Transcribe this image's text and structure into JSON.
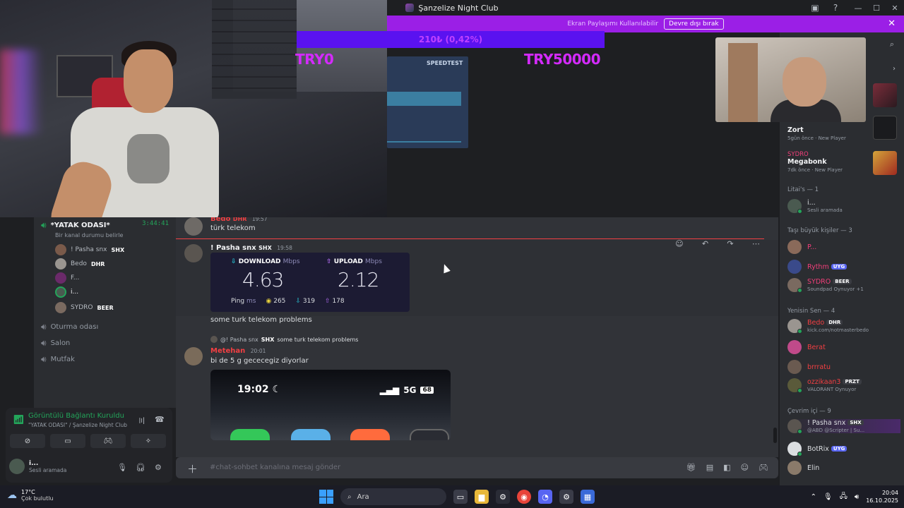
{
  "window": {
    "title": "Şanzelize Night Club"
  },
  "notice": {
    "text": "Ekran Paylaşımı Kullanılabilir",
    "button": "Devre dışı bırak"
  },
  "overlay": {
    "bar_text": "210₺ (0,42%)",
    "min_label": "TRY0",
    "max_label": "TRY50000",
    "speedtest_label": "SPEEDTEST"
  },
  "voice": {
    "channel_name": "*YATAK ODASI*",
    "channel_time": "3:44:41",
    "channel_status": "Bir kanal durumu belirle",
    "members": [
      {
        "name": "! Pasha snx",
        "tag": "SHX"
      },
      {
        "name": "Bedo",
        "tag": "DHR"
      },
      {
        "name": "F...",
        "tag": ""
      },
      {
        "name": "i...",
        "tag": ""
      },
      {
        "name": "SYDRO",
        "tag": "BEER"
      }
    ],
    "channels": [
      "Oturma odası",
      "Salon",
      "Mutfak"
    ]
  },
  "voice_panel": {
    "status": "Görüntülü Bağlantı Kuruldu",
    "location": "\"YATAK ODASI\" / Şanzelize Night Club",
    "user_name": "i...",
    "user_status": "Sesli aramada"
  },
  "chat": {
    "messages": [
      {
        "author": "Bedo",
        "tag": "DHR",
        "time": "19:57",
        "text": "türk telekom"
      },
      {
        "author": "! Pasha snx",
        "tag": "SHX",
        "time": "19:58",
        "text": "some turk telekom problems"
      },
      {
        "author": "Metehan",
        "tag": "",
        "time": "20:01",
        "text": "bi de 5 g gececegiz diyorlar"
      }
    ],
    "reply": {
      "author": "@! Pasha snx",
      "tag": "SHX",
      "text": "some turk telekom problems"
    },
    "speedtest": {
      "download_label": "DOWNLOAD",
      "upload_label": "UPLOAD",
      "unit": "Mbps",
      "download": "4.63",
      "upload": "2.12",
      "ping_label": "Ping",
      "ping_unit": "ms",
      "ping": "265",
      "ping_down": "319",
      "ping_up": "178"
    },
    "phone": {
      "time": "19:02",
      "network": "5G",
      "battery": "68"
    },
    "input_placeholder": "#chat-sohbet kanalına mesaj gönder"
  },
  "member_list": {
    "activities": [
      {
        "user": "",
        "title": "Zort",
        "age": "5gün önce",
        "badge": "New Player"
      },
      {
        "user": "SYDRO",
        "title": "Megabonk",
        "age": "7dk önce",
        "badge": "New Player"
      }
    ],
    "groups": [
      {
        "header": "Litai's — 1",
        "items": [
          {
            "name": "i...",
            "tag": "",
            "sub": "Sesli aramada",
            "color": "#dbdee1"
          }
        ]
      },
      {
        "header": "Taşı büyük kişiler — 3",
        "items": [
          {
            "name": "P...",
            "tag": "",
            "sub": "",
            "color": "#f23f7a"
          },
          {
            "name": "Rythm",
            "tag": "UYG",
            "sub": "",
            "color": "#f23f7a"
          },
          {
            "name": "SYDRO",
            "tag": "BEER",
            "sub": "Soundpad Oynuyor +1",
            "color": "#f23f7a"
          }
        ]
      },
      {
        "header": "Yenisin Sen — 4",
        "items": [
          {
            "name": "Bedo",
            "tag": "DHR",
            "sub": "kick.com/notmasterbedo",
            "color": "#f23f42"
          },
          {
            "name": "Berat",
            "tag": "",
            "sub": "",
            "color": "#f23f42"
          },
          {
            "name": "brrratu",
            "tag": "",
            "sub": "",
            "color": "#f23f42"
          },
          {
            "name": "ozzikaan3",
            "tag": "PRZT",
            "sub": "VALORANT Oynuyor",
            "color": "#f23f42"
          }
        ]
      },
      {
        "header": "Çevrim içi — 9",
        "items": [
          {
            "name": "! Pasha snx",
            "tag": "SHX",
            "sub": "@ABD @Scripter | Su...",
            "color": "#dbdee1"
          },
          {
            "name": "BotRix",
            "tag": "UYG",
            "sub": "",
            "color": "#dbdee1"
          },
          {
            "name": "Elin",
            "tag": "",
            "sub": "",
            "color": "#dbdee1"
          }
        ]
      }
    ]
  },
  "taskbar": {
    "temperature": "17°C",
    "weather": "Çok bulutlu",
    "search": "Ara",
    "time": "20:04",
    "date": "16.10.2025"
  },
  "colors": {
    "accent_purple": "#9b1fe6",
    "online": "#23a55a",
    "mention_red": "#f23f42"
  }
}
